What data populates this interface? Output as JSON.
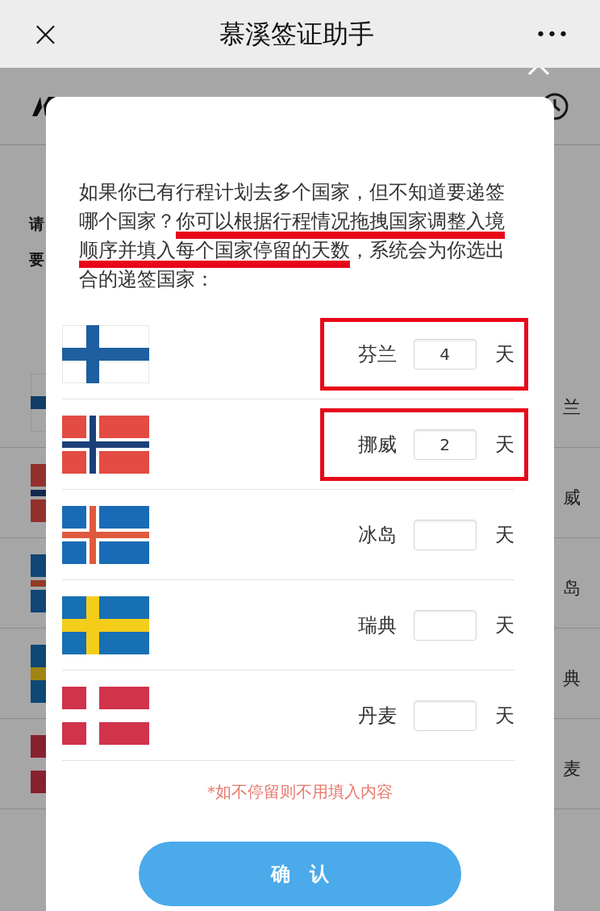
{
  "nav": {
    "title": "慕溪签证助手",
    "close": "×",
    "more": "•••"
  },
  "background": {
    "prompt_lines": [
      "请",
      "要"
    ],
    "rows": [
      {
        "kind": "finland",
        "label": "兰"
      },
      {
        "kind": "norway",
        "label": "威"
      },
      {
        "kind": "iceland",
        "label": "岛"
      },
      {
        "kind": "sweden",
        "label": "典"
      },
      {
        "kind": "denmark",
        "label": "麦"
      }
    ]
  },
  "dialog": {
    "intro": [
      {
        "text": "如果你已有行程计划去多个国家，但不知道要递签哪个国家？",
        "underlined": false
      },
      {
        "text": "你可以根据行程情况拖拽国家调整入境顺序并填入每个国家停留的天数",
        "underlined": true
      },
      {
        "text": "，系统会为你选出合的递签国家：",
        "underlined": false
      }
    ],
    "countries": [
      {
        "kind": "finland",
        "name": "芬兰",
        "days": "4",
        "unit": "天",
        "boxed": true
      },
      {
        "kind": "norway",
        "name": "挪威",
        "days": "2",
        "unit": "天",
        "boxed": true
      },
      {
        "kind": "iceland",
        "name": "冰岛",
        "unit": "天",
        "boxed": false
      },
      {
        "kind": "sweden",
        "name": "瑞典",
        "unit": "天",
        "boxed": false
      },
      {
        "kind": "denmark",
        "name": "丹麦",
        "unit": "天",
        "boxed": false
      }
    ],
    "note": "*如不停留则不用填入内容",
    "confirm": "确　认"
  }
}
